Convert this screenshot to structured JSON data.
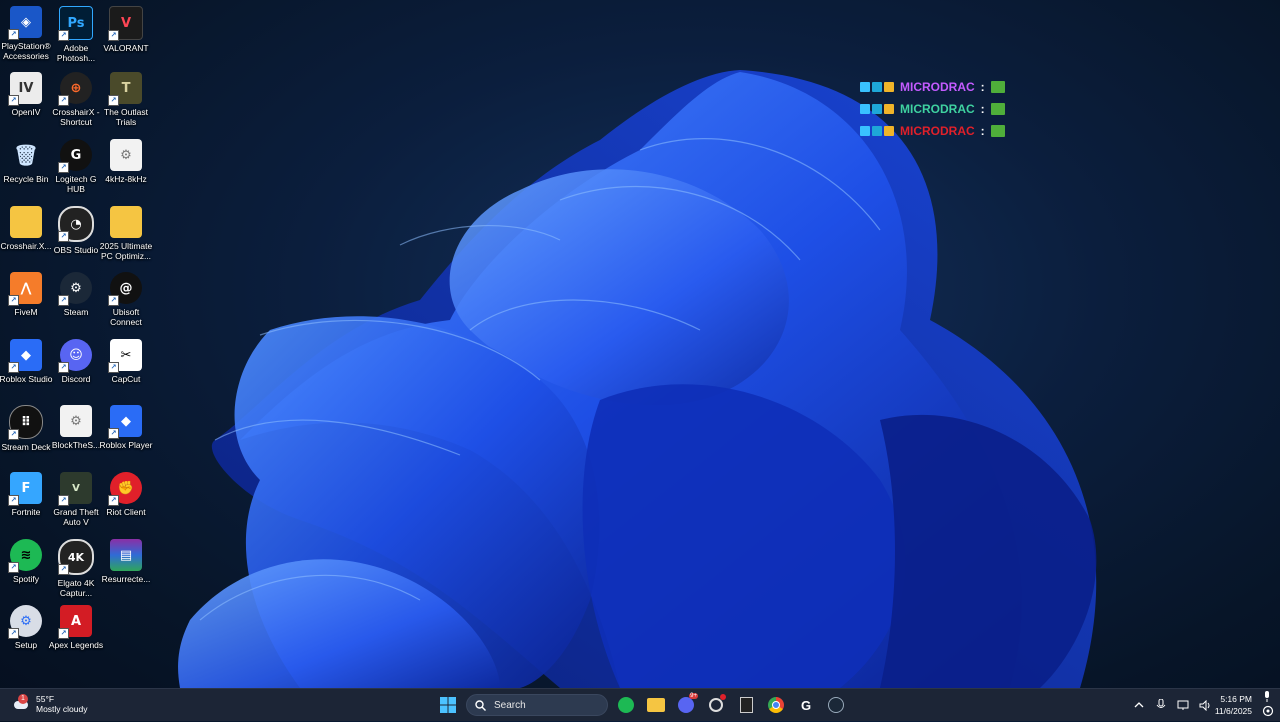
{
  "desktop_icons": [
    {
      "label": "PlayStation® Accessories",
      "icon": "playstation-icon"
    },
    {
      "label": "Adobe Photosh...",
      "icon": "photoshop-icon"
    },
    {
      "label": "VALORANT",
      "icon": "valorant-icon"
    },
    {
      "label": "OpenIV",
      "icon": "openiv-icon"
    },
    {
      "label": "CrosshairX - Shortcut",
      "icon": "crosshairx-icon"
    },
    {
      "label": "The Outlast Trials",
      "icon": "outlast-icon"
    },
    {
      "label": "Recycle Bin",
      "icon": "recycle-bin-icon"
    },
    {
      "label": "Logitech G HUB",
      "icon": "logitech-icon"
    },
    {
      "label": "4kHz-8kHz",
      "icon": "settings-file-icon"
    },
    {
      "label": "Crosshair.X...",
      "icon": "folder-icon"
    },
    {
      "label": "OBS Studio",
      "icon": "obs-icon"
    },
    {
      "label": "2025 Ultimate PC Optimiz...",
      "icon": "folder-zip-icon"
    },
    {
      "label": "FiveM",
      "icon": "fivem-icon"
    },
    {
      "label": "Steam",
      "icon": "steam-icon"
    },
    {
      "label": "Ubisoft Connect",
      "icon": "ubisoft-icon"
    },
    {
      "label": "Roblox Studio",
      "icon": "roblox-studio-icon"
    },
    {
      "label": "Discord",
      "icon": "discord-icon"
    },
    {
      "label": "CapCut",
      "icon": "capcut-icon"
    },
    {
      "label": "Stream Deck",
      "icon": "stream-deck-icon"
    },
    {
      "label": "BlockTheS...",
      "icon": "settings-file-icon"
    },
    {
      "label": "Roblox Player",
      "icon": "roblox-icon"
    },
    {
      "label": "Fortnite",
      "icon": "fortnite-icon"
    },
    {
      "label": "Grand Theft Auto V",
      "icon": "gta-icon"
    },
    {
      "label": "Riot Client",
      "icon": "riot-icon"
    },
    {
      "label": "Spotify",
      "icon": "spotify-icon"
    },
    {
      "label": "Elgato 4K Captur...",
      "icon": "elgato-icon"
    },
    {
      "label": "Resurrecte...",
      "icon": "winrar-icon"
    },
    {
      "label": "Setup",
      "icon": "setup-icon"
    },
    {
      "label": "Apex Legends",
      "icon": "apex-icon"
    }
  ],
  "overlay": {
    "rows": [
      {
        "name": "MICRODRAC",
        "sep": ":",
        "color": "#c45bff"
      },
      {
        "name": "MICRODRAC",
        "sep": ":",
        "color": "#3fd2a0"
      },
      {
        "name": "MICRODRAC",
        "sep": ":",
        "color": "#e0202a"
      }
    ]
  },
  "taskbar": {
    "weather": {
      "temp": "55°F",
      "condition": "Mostly cloudy",
      "badge": "1"
    },
    "search_placeholder": "Search",
    "apps": [
      "start-icon",
      "search",
      "spotify-icon",
      "file-explorer-icon",
      "discord-icon",
      "crosshair-icon",
      "epic-games-icon",
      "chrome-icon",
      "logitech-icon",
      "steam-icon"
    ],
    "discord_badge": "9+",
    "clock": {
      "time": "5:16 PM",
      "date": "11/6/2025"
    }
  },
  "colors": {
    "taskbar_bg": "#1c2536",
    "wallpaper_accent": "#1f5fff"
  }
}
